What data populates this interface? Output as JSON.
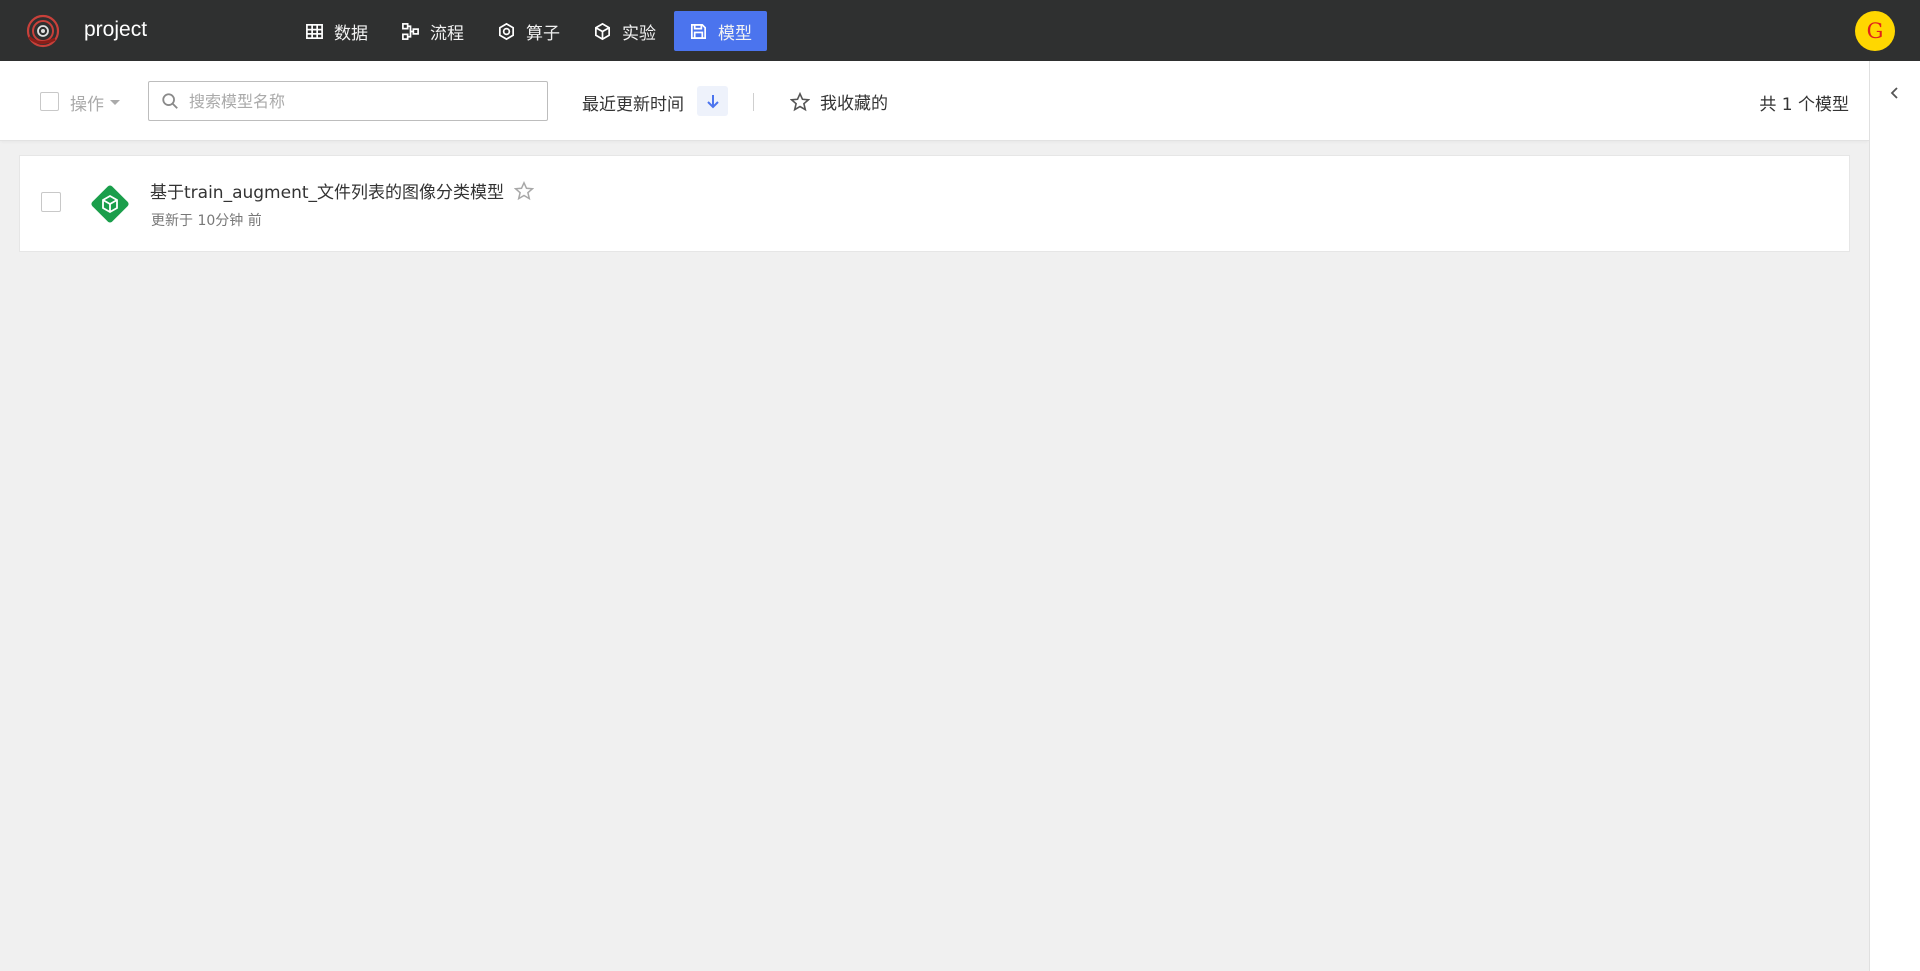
{
  "header": {
    "project_name": "project",
    "nav": [
      {
        "label": "数据",
        "icon": "table-icon",
        "active": false
      },
      {
        "label": "流程",
        "icon": "flow-icon",
        "active": false
      },
      {
        "label": "算子",
        "icon": "hexagon-icon",
        "active": false
      },
      {
        "label": "实验",
        "icon": "cube-icon",
        "active": false
      },
      {
        "label": "模型",
        "icon": "save-icon",
        "active": true
      }
    ],
    "avatar_letter": "G",
    "colors": {
      "bar": "#2f3030",
      "active": "#4b74ee",
      "avatar_bg": "#ffd700",
      "avatar_fg": "#e0211b"
    }
  },
  "toolbar": {
    "operations_label": "操作",
    "search_placeholder": "搜索模型名称",
    "sort_label": "最近更新时间",
    "favorites_label": "我收藏的",
    "total_count": "共 1 个模型"
  },
  "models": [
    {
      "name": "基于train_augment_文件列表的图像分类模型",
      "updated": "更新于 10分钟 前",
      "icon": "model-cube-icon",
      "icon_color": "#1a9e4b",
      "starred": false
    }
  ]
}
